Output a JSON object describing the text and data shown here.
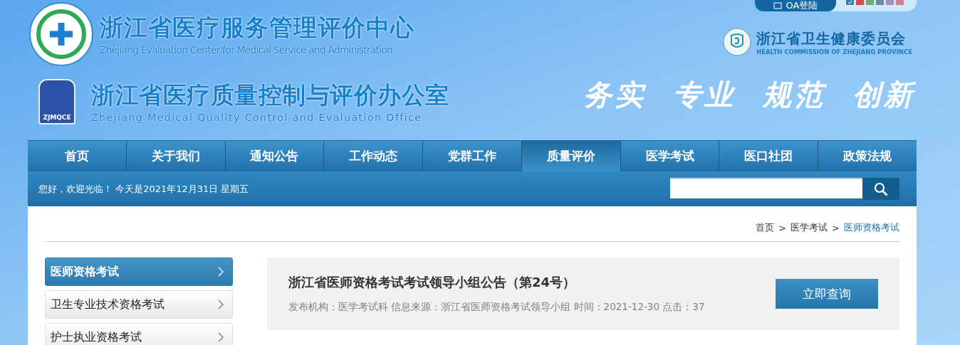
{
  "header": {
    "center_title": "浙江省医疗服务管理评价中心",
    "center_subtitle": "Zhejiang Evaluation Center for Medical Service and Administration",
    "office_title": "浙江省医疗质量控制与评价办公室",
    "office_subtitle": "Zhejiang Medical Quality Control and Evaluation Office",
    "logo_caption": "ZJMQCE",
    "oa_login": "OA登陆",
    "theme_swatches": [
      {
        "color": "#3a7ab8",
        "selected": true
      },
      {
        "color": "#e0444c",
        "selected": false
      },
      {
        "color": "#6bac78",
        "selected": false
      },
      {
        "color": "#6e8a94",
        "selected": false
      },
      {
        "color": "#a98cc0",
        "selected": false
      },
      {
        "color": "#cc8088",
        "selected": false
      }
    ],
    "commission_title": "浙江省卫生健康委员会",
    "commission_subtitle": "HEALTH COMMISSION OF ZHEJIANG PROVINCE",
    "slogan": [
      "务实",
      "专业",
      "规范",
      "创新"
    ]
  },
  "nav": [
    {
      "label": "首页",
      "selected": false
    },
    {
      "label": "关于我们",
      "selected": false
    },
    {
      "label": "通知公告",
      "selected": false
    },
    {
      "label": "工作动态",
      "selected": false
    },
    {
      "label": "党群工作",
      "selected": false
    },
    {
      "label": "质量评价",
      "selected": true
    },
    {
      "label": "医学考试",
      "selected": false
    },
    {
      "label": "医口社团",
      "selected": false
    },
    {
      "label": "政策法规",
      "selected": false
    }
  ],
  "welcome": "您好，欢迎光临！ 今天是2021年12月31日 星期五",
  "breadcrumb": [
    {
      "text": "首页",
      "kind": "link"
    },
    {
      "text": ">",
      "kind": "separator"
    },
    {
      "text": "医学考试",
      "kind": "link"
    },
    {
      "text": ">",
      "kind": "separator"
    },
    {
      "text": "医师资格考试",
      "kind": "current"
    }
  ],
  "sidebar": {
    "items": [
      {
        "label": "医师资格考试",
        "selected": true
      },
      {
        "label": "卫生专业技术资格考试",
        "selected": false
      },
      {
        "label": "护士执业资格考试",
        "selected": false
      }
    ]
  },
  "article": {
    "title": "浙江省医师资格考试考试领导小组公告（第24号）",
    "meta": "发布机构：医学考试科 信息来源：浙江省医师资格考试领导小组 时间：2021-12-30 点击：37",
    "button": "立即查询"
  }
}
